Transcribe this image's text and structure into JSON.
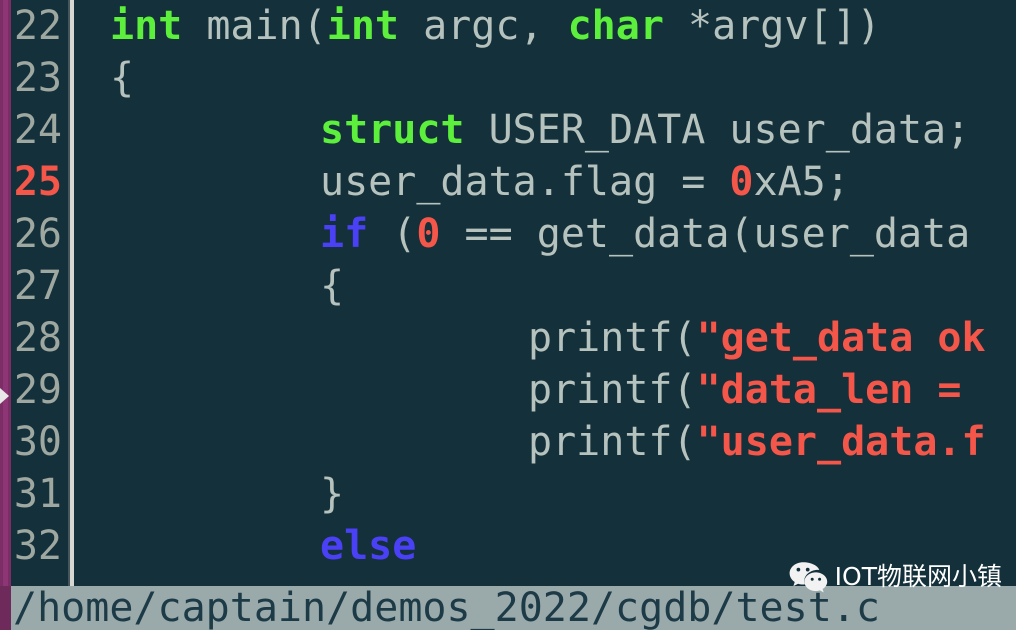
{
  "app": {
    "name": "cgdb",
    "file_path": "/home/captain/demos_2022/cgdb/test.c"
  },
  "colors": {
    "background": "#14303a",
    "gutter_text": "#9fa8a0",
    "current_line_number": "#f4564a",
    "keyword": "#5cf03c",
    "conditional": "#4a40f5",
    "number_literal": "#f4564a",
    "string_literal": "#f4564a",
    "plain_text": "#b6c2bd",
    "left_strip": "#8e3575",
    "statusbar_background": "#9aaaab",
    "statusbar_text": "#1d3a47",
    "separator": "#d6d6d2"
  },
  "editor": {
    "current_line": 25,
    "marker_line": 29,
    "lines": [
      {
        "number": "22",
        "current": false,
        "indent": 36,
        "tokens": [
          {
            "text": "int",
            "type": "key"
          },
          {
            "text": " main(",
            "type": "plain"
          },
          {
            "text": "int",
            "type": "key"
          },
          {
            "text": " argc, ",
            "type": "plain"
          },
          {
            "text": "char",
            "type": "key"
          },
          {
            "text": " *argv[])",
            "type": "plain"
          }
        ]
      },
      {
        "number": "23",
        "current": false,
        "indent": 36,
        "tokens": [
          {
            "text": "{",
            "type": "plain"
          }
        ]
      },
      {
        "number": "24",
        "current": false,
        "indent": 246,
        "tokens": [
          {
            "text": "struct",
            "type": "key"
          },
          {
            "text": " USER_DATA user_data;",
            "type": "plain"
          }
        ]
      },
      {
        "number": "25",
        "current": true,
        "indent": 246,
        "tokens": [
          {
            "text": "user_data.flag = ",
            "type": "plain"
          },
          {
            "text": "0",
            "type": "num"
          },
          {
            "text": "xA5;",
            "type": "plain"
          }
        ]
      },
      {
        "number": "26",
        "current": false,
        "indent": 246,
        "tokens": [
          {
            "text": "if",
            "type": "cond"
          },
          {
            "text": " (",
            "type": "plain"
          },
          {
            "text": "0",
            "type": "num"
          },
          {
            "text": " == get_data(user_data",
            "type": "plain"
          }
        ]
      },
      {
        "number": "27",
        "current": false,
        "indent": 246,
        "tokens": [
          {
            "text": "{",
            "type": "plain"
          }
        ]
      },
      {
        "number": "28",
        "current": false,
        "indent": 454,
        "tokens": [
          {
            "text": "printf(",
            "type": "plain"
          },
          {
            "text": "\"get_data ok",
            "type": "str"
          }
        ]
      },
      {
        "number": "29",
        "current": false,
        "indent": 454,
        "tokens": [
          {
            "text": "printf(",
            "type": "plain"
          },
          {
            "text": "\"data_len = ",
            "type": "str"
          }
        ]
      },
      {
        "number": "30",
        "current": false,
        "indent": 454,
        "tokens": [
          {
            "text": "printf(",
            "type": "plain"
          },
          {
            "text": "\"user_data.f",
            "type": "str"
          }
        ]
      },
      {
        "number": "31",
        "current": false,
        "indent": 246,
        "tokens": [
          {
            "text": "}",
            "type": "plain"
          }
        ]
      },
      {
        "number": "32",
        "current": false,
        "indent": 246,
        "tokens": [
          {
            "text": "else",
            "type": "cond"
          }
        ]
      }
    ]
  },
  "watermark": {
    "label": "IOT物联网小镇",
    "icon": "wechat-icon"
  }
}
